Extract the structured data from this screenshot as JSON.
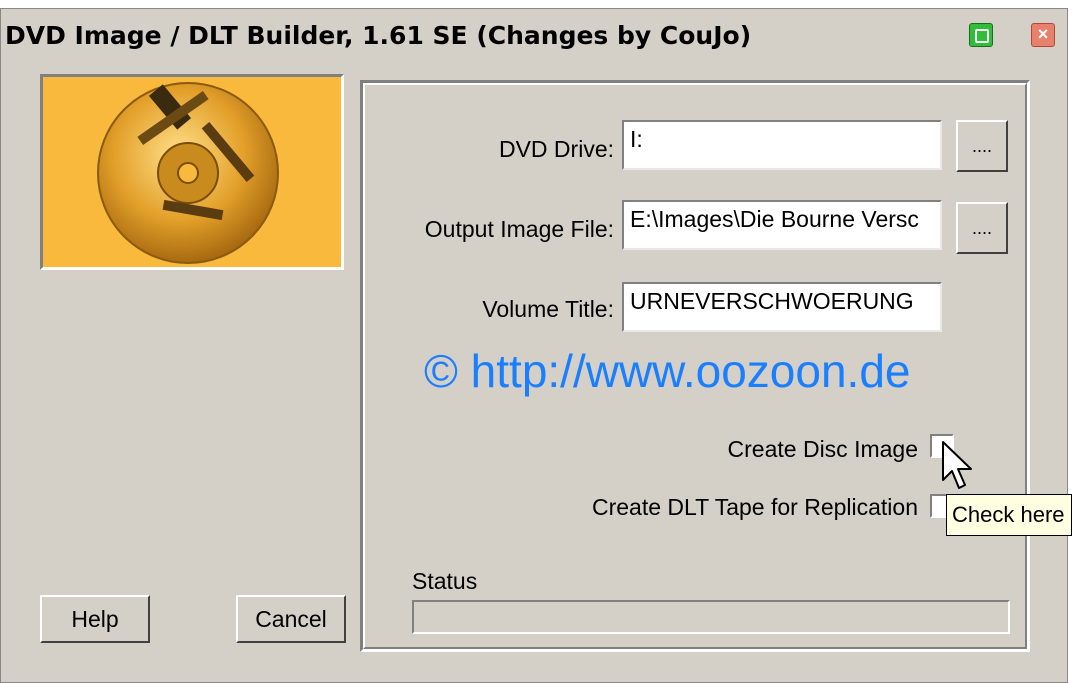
{
  "window": {
    "title": "DVD Image / DLT Builder, 1.61 SE (Changes by CouJo)",
    "close_glyph": "×"
  },
  "buttons": {
    "help": "Help",
    "cancel": "Cancel",
    "browse": "...."
  },
  "form": {
    "dvd_drive": {
      "label": "DVD Drive:",
      "value": "I:"
    },
    "output_image": {
      "label": "Output Image File:",
      "value": "E:\\Images\\Die Bourne Versc"
    },
    "volume_title": {
      "label": "Volume Title:",
      "value": "URNEVERSCHWOERUNG"
    }
  },
  "watermark": "© http://www.oozoon.de",
  "options": {
    "create_disc_image": {
      "label": "Create Disc Image",
      "checked": false
    },
    "create_dlt_tape": {
      "label": "Create DLT Tape for Replication",
      "checked": false
    }
  },
  "tooltip": "Check here",
  "status": {
    "label": "Status",
    "progress": 0
  },
  "colors": {
    "window_bg": "#d4d0c8",
    "logo_bg": "#f9b93c",
    "link_blue": "#1a7fff",
    "tooltip_bg": "#ffffe1"
  },
  "icons": [
    "disc-tools-logo",
    "minimize-icon",
    "close-icon",
    "mouse-cursor-icon"
  ]
}
